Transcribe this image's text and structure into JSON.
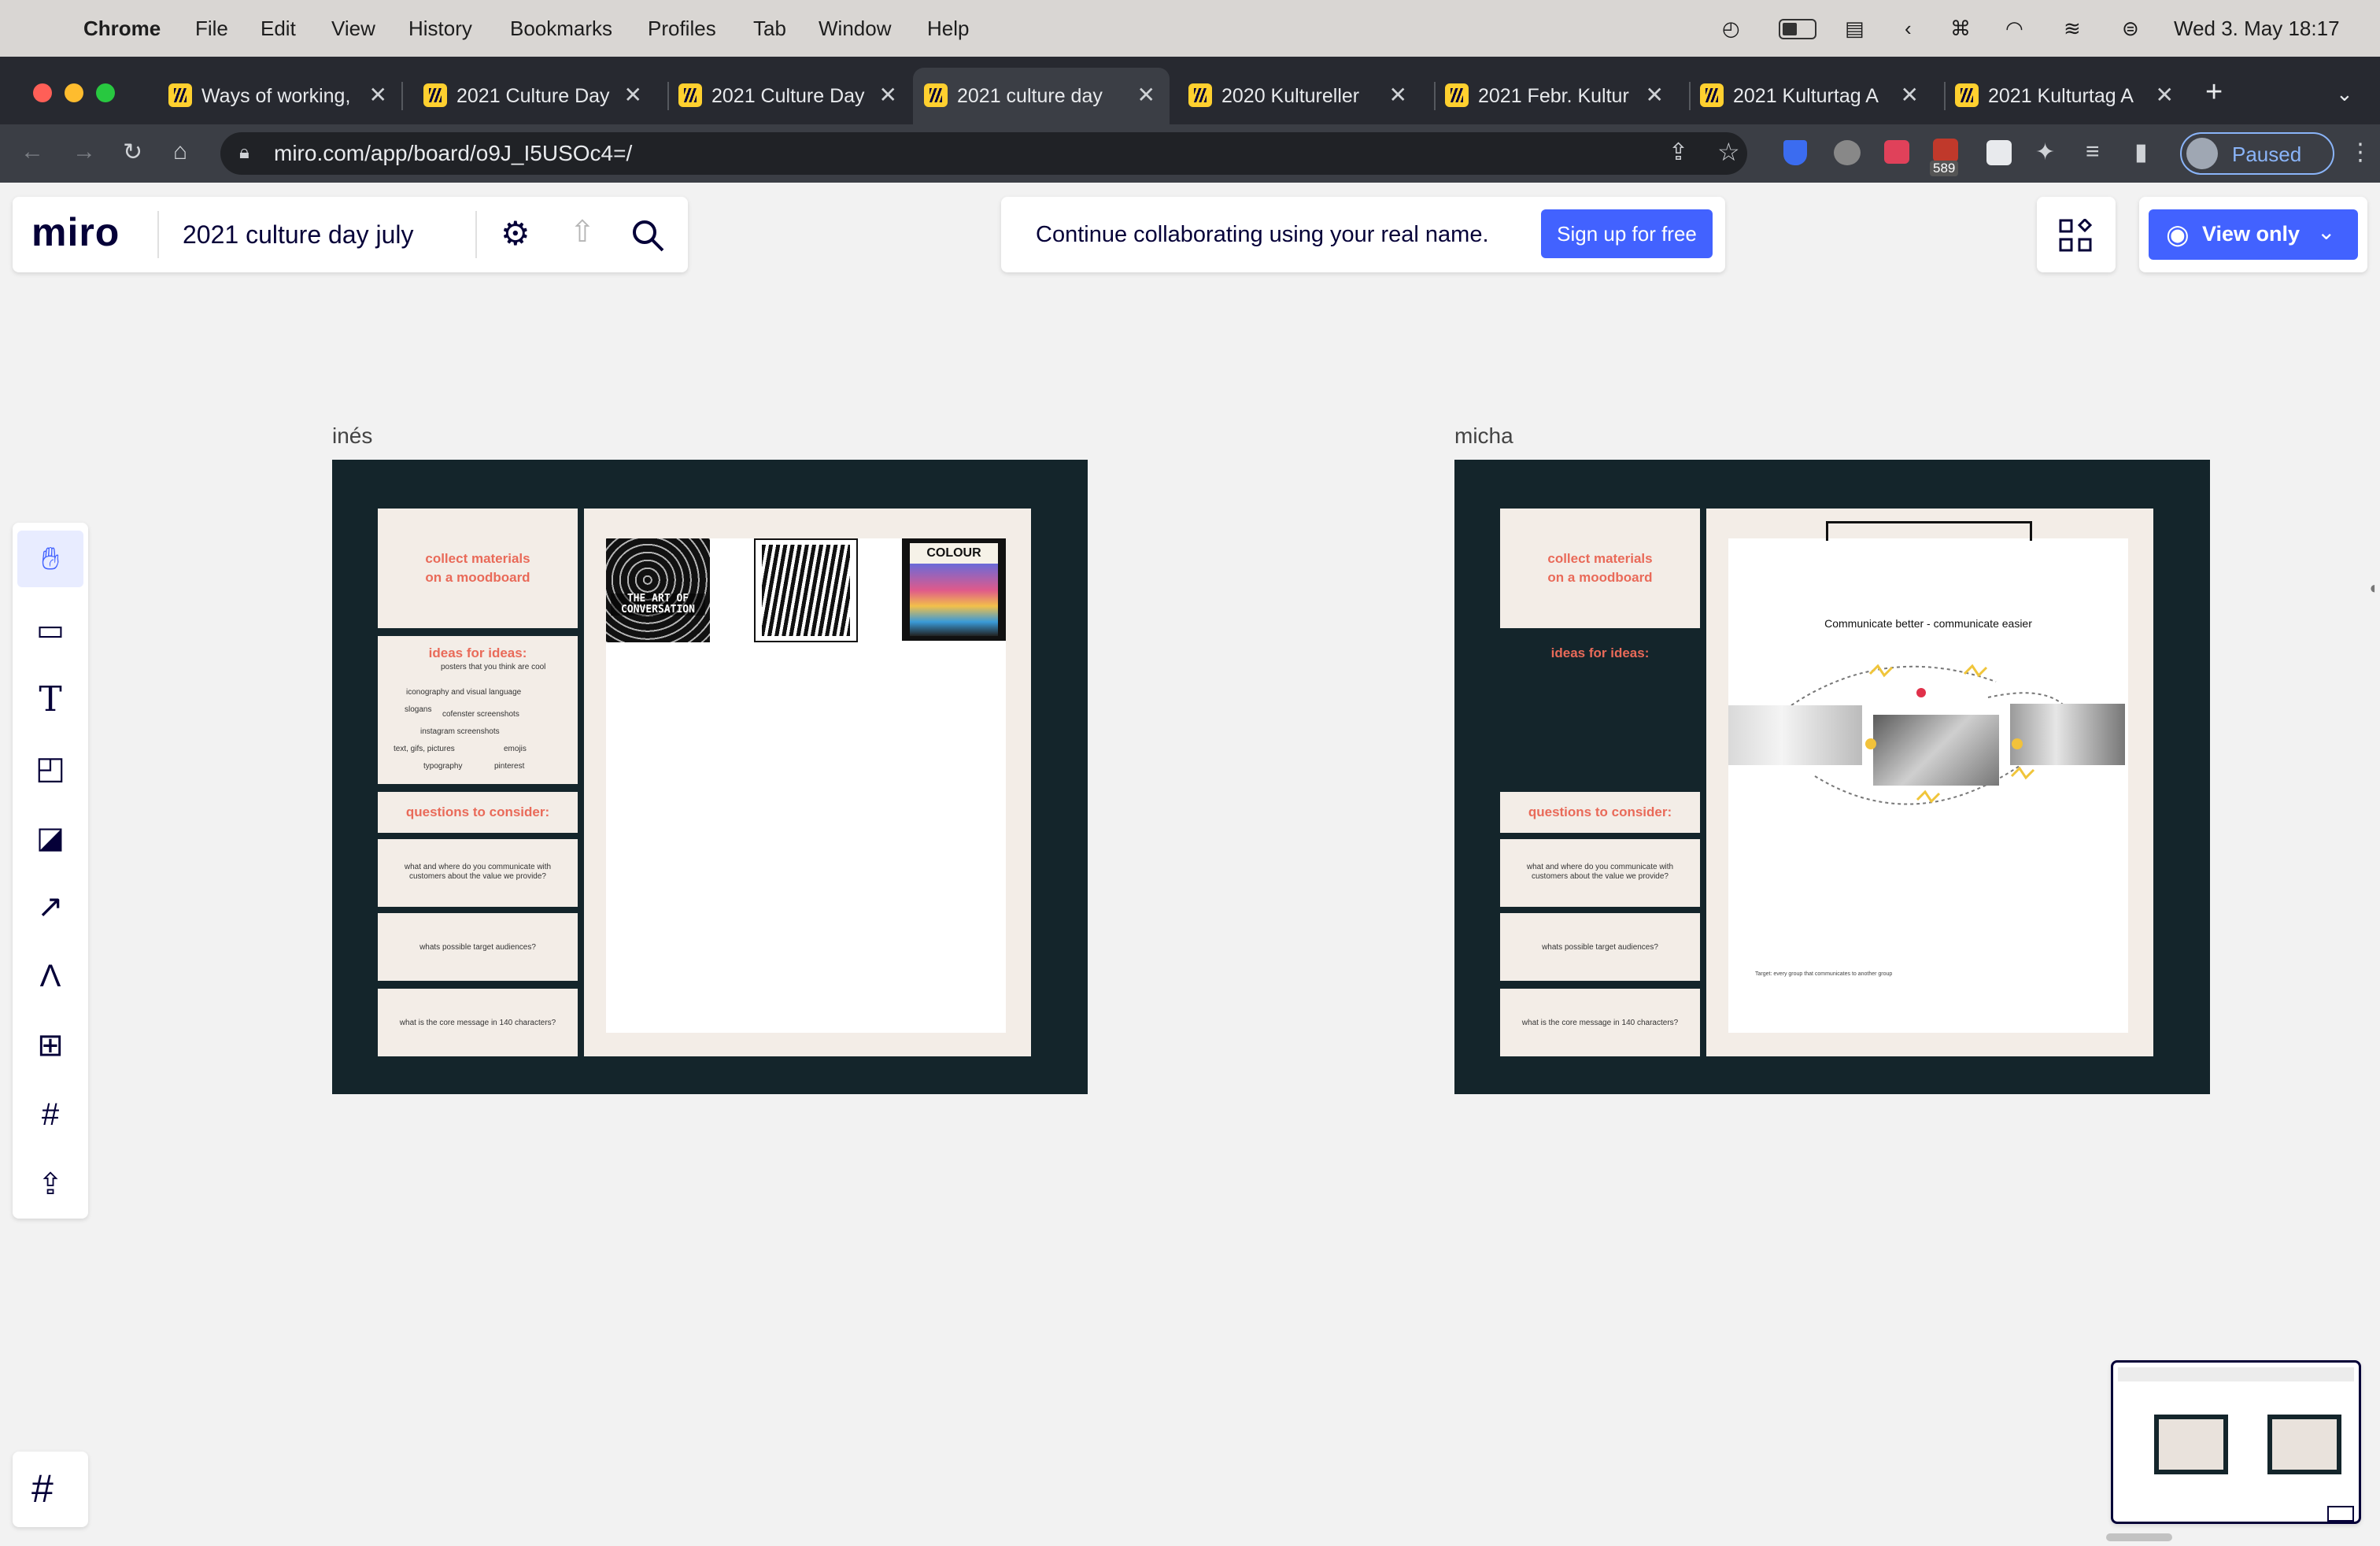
{
  "menubar": {
    "app": "Chrome",
    "items": [
      "File",
      "Edit",
      "View",
      "History",
      "Bookmarks",
      "Profiles",
      "Tab",
      "Window",
      "Help"
    ],
    "datetime": "Wed 3. May  18:17"
  },
  "tabs": [
    {
      "label": "Ways of working,",
      "active": false
    },
    {
      "label": "2021 Culture Day",
      "active": false
    },
    {
      "label": "2021 Culture Day",
      "active": false
    },
    {
      "label": "2021 culture day",
      "active": true
    },
    {
      "label": "2020 Kultureller",
      "active": false
    },
    {
      "label": "2021 Febr. Kultur",
      "active": false
    },
    {
      "label": "2021 Kulturtag A",
      "active": false
    },
    {
      "label": "2021 Kulturtag A",
      "active": false
    }
  ],
  "browser": {
    "url": "miro.com/app/board/o9J_I5USOc4=/",
    "profile_label": "Paused",
    "badge_count": "589"
  },
  "miro": {
    "logo": "miro",
    "board_title": "2021 culture day july",
    "banner_text": "Continue collaborating using your real name.",
    "signup_label": "Sign up for free",
    "view_only_label": "View only"
  },
  "boards": {
    "left": {
      "name": "inés",
      "collect": "collect materials on a moodboard",
      "ideas_title": "ideas for ideas:",
      "ideas": [
        "posters that you think are cool",
        "iconography and visual language",
        "slogans",
        "cofenster screenshots",
        "instagram screenshots",
        "text, gifs, pictures",
        "emojis",
        "typography",
        "pinterest"
      ],
      "questions_title": "questions to consider:",
      "q1": "what and where do you communicate with customers about the value we provide?",
      "q2": "whats possible target audiences?",
      "q3": "what is the core message in 140 characters?",
      "poster1": "THE ART OF CONVERSATION",
      "poster3": "COLOUR"
    },
    "right": {
      "name": "micha",
      "collect": "collect materials on a moodboard",
      "ideas_title": "ideas for ideas:",
      "questions_title": "questions to consider:",
      "q1": "what and where do you communicate with customers about the value we provide?",
      "q2": "whats possible target audiences?",
      "q3": "what is the core message in 140 characters?",
      "slide_title": "Communicate better - communicate easier",
      "target_note": "Target: every group that communicates to another group"
    }
  },
  "icons": {
    "sidebar": [
      "hand-icon",
      "comment-icon",
      "text-icon",
      "sticky-note-icon",
      "shapes-icon",
      "arrow-icon",
      "pen-icon",
      "templates-icon",
      "frame-icon",
      "upload-icon"
    ]
  }
}
